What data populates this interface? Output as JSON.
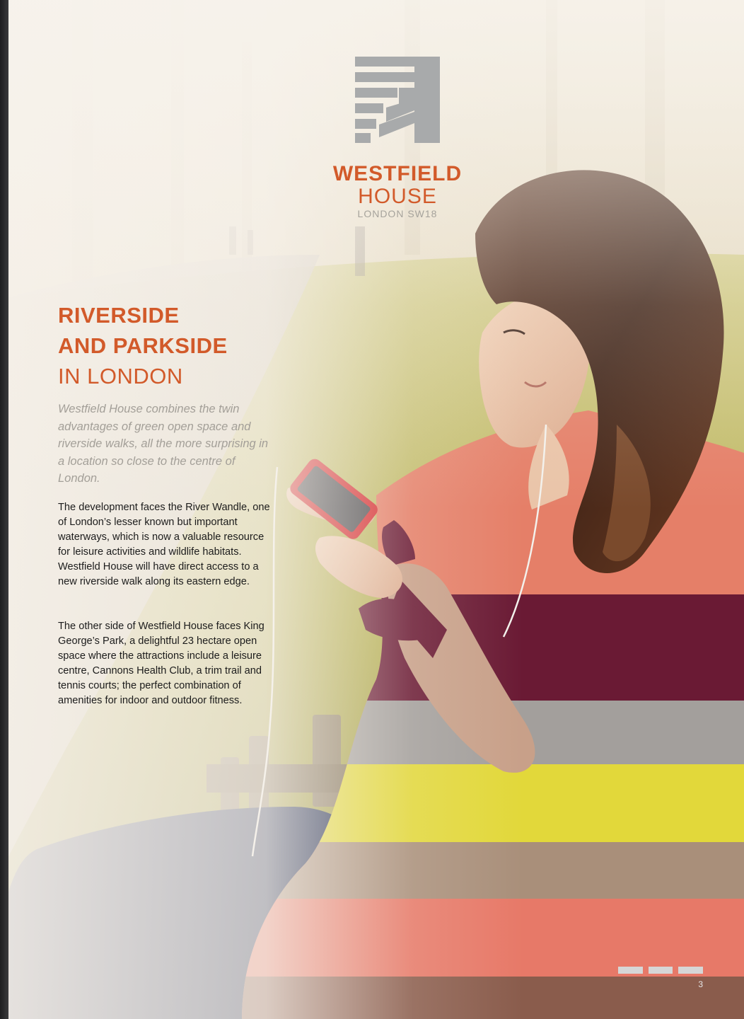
{
  "brand": {
    "line1": "WESTFIELD",
    "line2": "HOUSE",
    "line3": "LONDON SW18",
    "accent_color": "#d25a2a",
    "logo_mark_color": "#a8aaab"
  },
  "headline": {
    "line1": "RIVERSIDE",
    "line2": "AND PARKSIDE",
    "line3": "IN LONDON"
  },
  "intro": "Westfield House combines the twin advantages of green open space and riverside walks, all the more surprising in a location so close to the centre of London.",
  "paragraphs": [
    "The development faces the River Wandle, one of London’s lesser known but important waterways, which is now a valuable resource for leisure activities and wildlife habitats. Westfield House will have direct access to a new riverside walk along its eastern edge.",
    "The other side of Westfield House faces King George’s Park, a delightful 23 hectare open space where the attractions include a leisure centre, Cannons Health Club, a trim trail and tennis courts; the perfect combination of amenities for indoor and outdoor fitness."
  ],
  "page_number": "3",
  "photo_icon": "woman-on-park-bench-with-phone-photo"
}
